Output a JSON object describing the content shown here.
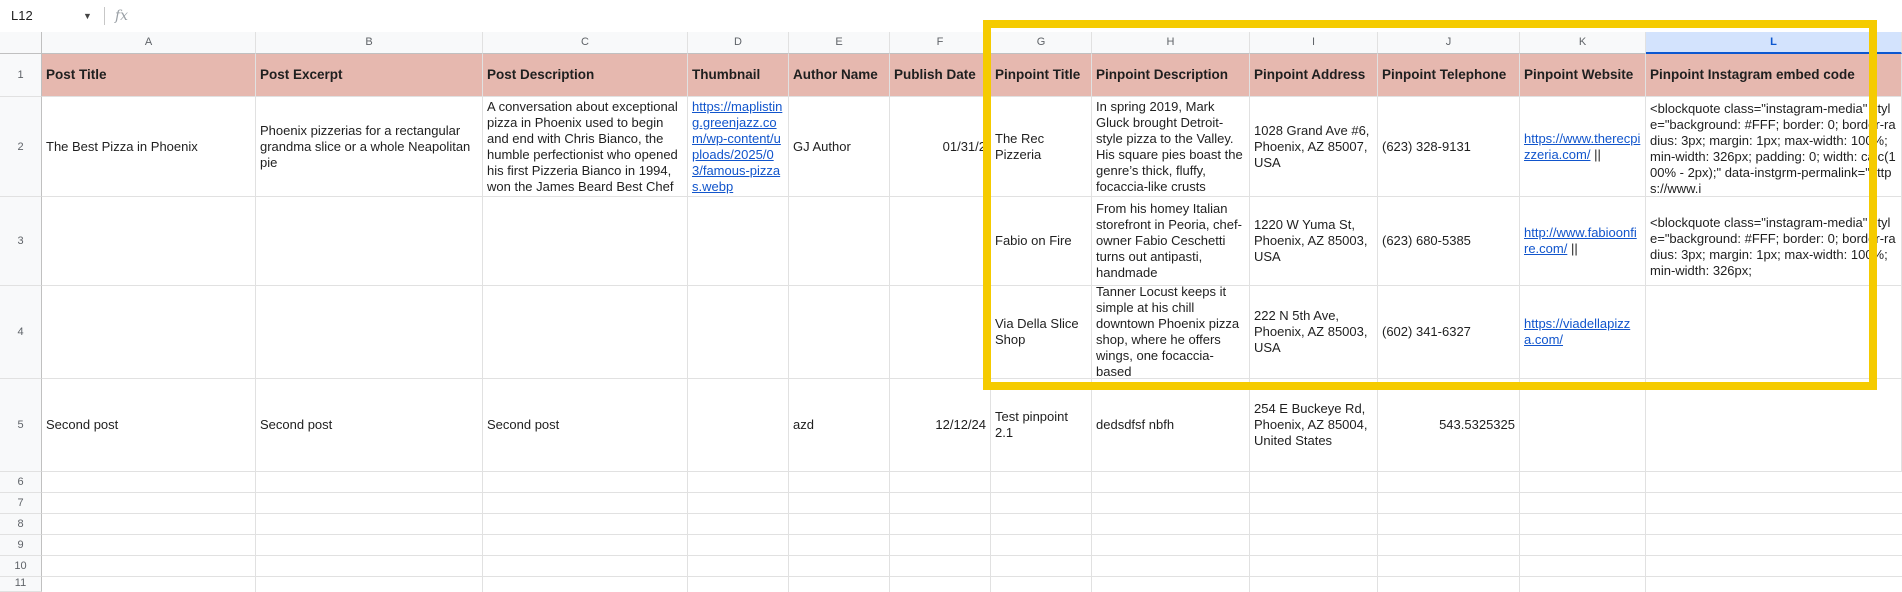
{
  "toolbar": {
    "name_box": "L12",
    "fx_label": "fx",
    "formula_value": ""
  },
  "colors": {
    "header_fill": "#e6b8af",
    "highlight": "#f5cb00",
    "link": "#1155cc",
    "selected_col": "#d3e3fd"
  },
  "columns": [
    "A",
    "B",
    "C",
    "D",
    "E",
    "F",
    "G",
    "H",
    "I",
    "J",
    "K",
    "L"
  ],
  "rows": [
    "1",
    "2",
    "3",
    "4",
    "5",
    "6",
    "7",
    "8",
    "9",
    "10",
    "11"
  ],
  "headers": {
    "A": "Post Title",
    "B": "Post Excerpt",
    "C": "Post Description",
    "D": "Thumbnail",
    "E": "Author Name",
    "F": "Publish Date",
    "G": "Pinpoint Title",
    "H": "Pinpoint Description",
    "I": "Pinpoint Address",
    "J": "Pinpoint Telephone",
    "K": "Pinpoint Website",
    "L": "Pinpoint Instagram embed code"
  },
  "cells": {
    "A2": "The Best Pizza in Phoenix",
    "B2": "Phoenix pizzerias for a rectangular grandma slice or a whole Neapolitan pie",
    "C2": "A conversation about exceptional pizza in Phoenix used to begin and end with Chris Bianco, the humble perfectionist who opened his first Pizzeria Bianco in 1994, won the James Beard Best Chef",
    "D2": "https://maplisting.greenjazz.com/wp-content/uploads/2025/03/famous-pizzas.webp",
    "E2": "GJ Author",
    "F2": "01/31/2",
    "G2": "The Rec Pizzeria",
    "H2": "In spring 2019, Mark Gluck brought Detroit-style pizza to the Valley. His square pies boast the genre’s thick, fluffy, focaccia-like crusts",
    "I2": "1028 Grand Ave #6, Phoenix, AZ 85007, USA",
    "J2": "(623) 328-9131",
    "K2": "https://www.therecpizzeria.com/",
    "K2_suffix": "||",
    "L2": "<blockquote class=\"instagram-media\" style=\"background: #FFF; border: 0; border-radius: 3px; margin: 1px; max-width: 100%; min-width: 326px; padding: 0; width: calc(100% - 2px);\" data-instgrm-permalink=\"https://www.i",
    "G3": "Fabio on Fire",
    "H3": "From his homey Italian storefront in Peoria, chef-owner Fabio Ceschetti turns out antipasti, handmade",
    "I3": "1220 W Yuma St, Phoenix, AZ 85003, USA",
    "J3": "(623) 680-5385",
    "K3": "http://www.fabioonfire.com/",
    "K3_suffix": "||",
    "L3": "<blockquote class=\"instagram-media\" style=\"background: #FFF; border: 0; border-radius: 3px; margin: 1px; max-width: 100%; min-width: 326px;",
    "G4": "Via Della Slice Shop",
    "H4": "Tanner Locust keeps it simple at his chill downtown Phoenix pizza shop, where he offers wings, one focaccia-based",
    "I4": "222 N 5th Ave, Phoenix, AZ 85003, USA",
    "J4": "(602) 341-6327",
    "K4": "https://viadellapizza.com/",
    "A5": "Second post",
    "B5": "Second post",
    "C5": "Second post",
    "E5": "azd",
    "F5": "12/12/24",
    "G5": "Test pinpoint 2.1",
    "H5": "dedsdfsf nbfh",
    "I5": "254 E Buckeye Rd, Phoenix, AZ 85004, United States",
    "J5": "543.5325325"
  }
}
